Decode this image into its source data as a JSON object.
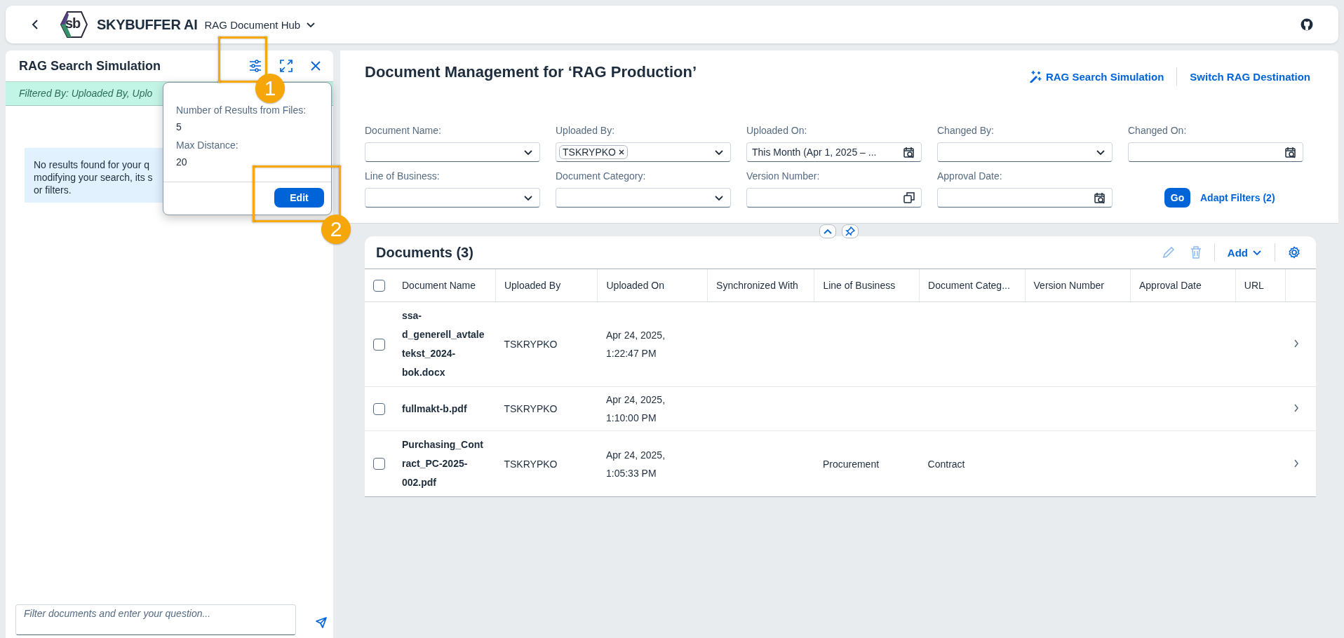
{
  "header": {
    "logo_text": "sb",
    "app_name": "SKYBUFFER AI",
    "menu_title": "RAG Document Hub"
  },
  "side_panel": {
    "title": "RAG Search Simulation",
    "filter_info": "Filtered By: Uploaded By, Uplo",
    "message_lines": [
      "No results found for your q",
      "modifying your search, its s",
      "or filters."
    ],
    "question_field": {
      "placeholder": "Filter documents and enter your question..."
    }
  },
  "popover": {
    "fields": [
      {
        "label": "Number of Results from Files:",
        "value": "5"
      },
      {
        "label": "Max Distance:",
        "value": "20"
      }
    ],
    "button": "Edit"
  },
  "callouts": [
    {
      "number": "1"
    },
    {
      "number": "2"
    }
  ],
  "page": {
    "title": "Document Management for ‘RAG Production’",
    "actions": [
      {
        "kind": "icon-link",
        "label": "RAG Search Simulation"
      },
      {
        "kind": "link",
        "label": "Switch RAG Destination"
      }
    ]
  },
  "filters": [
    {
      "kind": "dropdown",
      "label": "Document Name:"
    },
    {
      "kind": "dropdown",
      "label": "Uploaded By:",
      "tokens": [
        "TSKRYPKO"
      ]
    },
    {
      "kind": "date",
      "label": "Uploaded On:",
      "value": "This Month (Apr 1, 2025 – ..."
    },
    {
      "kind": "dropdown",
      "label": "Changed By:"
    },
    {
      "kind": "date",
      "label": "Changed On:"
    },
    {
      "kind": "dropdown",
      "label": "Line of Business:"
    },
    {
      "kind": "dropdown",
      "label": "Document Category:"
    },
    {
      "kind": "value-help",
      "label": "Version Number:"
    },
    {
      "kind": "date",
      "label": "Approval Date:"
    }
  ],
  "filter_buttons": {
    "go": "Go",
    "adapt": "Adapt Filters (2)"
  },
  "table": {
    "title": "Documents (3)",
    "toolbar": [
      {
        "kind": "edit",
        "disabled": true
      },
      {
        "kind": "delete",
        "disabled": true
      },
      {
        "kind": "menu",
        "label": "Add",
        "disabled": false
      },
      {
        "kind": "settings",
        "disabled": false
      }
    ],
    "select_all": {
      "checked": false
    },
    "columns": [
      "Document Name",
      "Uploaded By",
      "Uploaded On",
      "Synchronized With",
      "Line of Business",
      "Document Categ...",
      "Version Number",
      "Approval Date",
      "URL"
    ],
    "rows": [
      {
        "selected": false,
        "cells": [
          "ssa-d_generell_avtaletekst_2024-bok.docx",
          "TSKRYPKO",
          "Apr 24, 2025, 1:22:47 PM",
          "",
          "",
          "",
          "",
          "",
          ""
        ]
      },
      {
        "selected": false,
        "cells": [
          "fullmakt-b.pdf",
          "TSKRYPKO",
          "Apr 24, 2025, 1:10:00 PM",
          "",
          "",
          "",
          "",
          "",
          ""
        ]
      },
      {
        "selected": false,
        "cells": [
          "Purchasing_Contract_PC-2025-002.pdf",
          "TSKRYPKO",
          "Apr 24, 2025, 1:05:33 PM",
          "",
          "Procurement",
          "Contract",
          "",
          "",
          ""
        ]
      }
    ]
  }
}
